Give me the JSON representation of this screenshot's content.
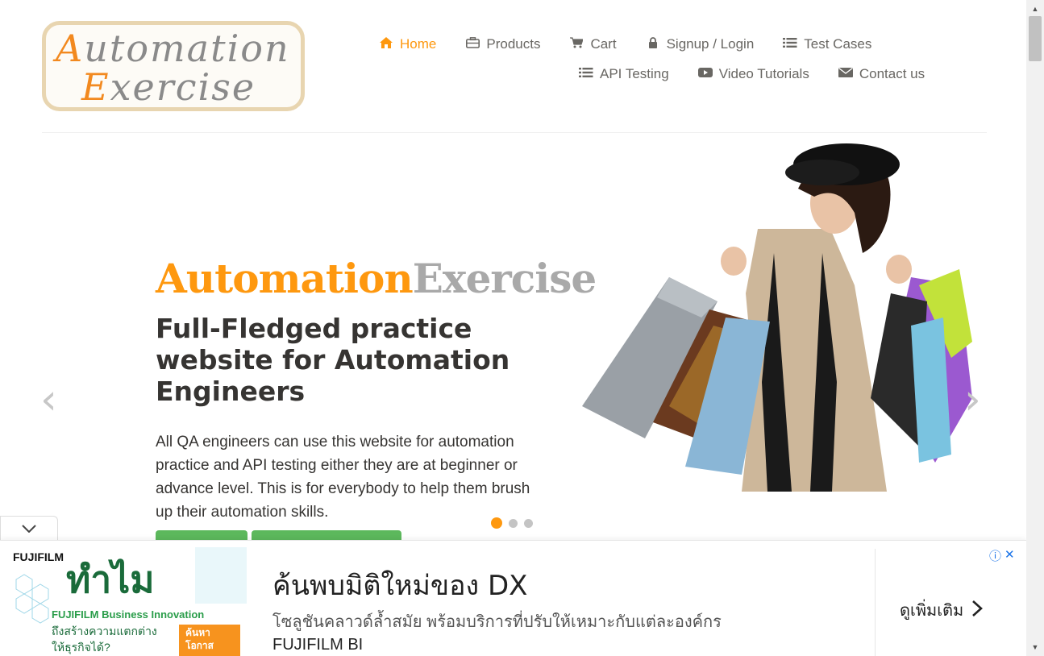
{
  "logo": {
    "line1_cap": "A",
    "line1_rest": "utomation",
    "line2_cap": "E",
    "line2_rest": "xercise"
  },
  "nav": {
    "row1": [
      {
        "label": "Home",
        "icon": "home-icon",
        "active": true
      },
      {
        "label": "Products",
        "icon": "briefcase-icon"
      },
      {
        "label": "Cart",
        "icon": "cart-icon"
      },
      {
        "label": "Signup / Login",
        "icon": "lock-icon"
      },
      {
        "label": "Test Cases",
        "icon": "list-icon"
      }
    ],
    "row2": [
      {
        "label": "API Testing",
        "icon": "list-icon"
      },
      {
        "label": "Video Tutorials",
        "icon": "youtube-icon"
      },
      {
        "label": "Contact us",
        "icon": "envelope-icon"
      }
    ]
  },
  "slider": {
    "brand_part1": "Automation",
    "brand_part2": "Exercise",
    "headline": "Full-Fledged practice website for Automation Engineers",
    "description": "All QA engineers can use this website for automation practice and API testing either they are at beginner or advance level. This is for everybody to help them brush up their automation skills.",
    "prev_arrow": "‹",
    "next_arrow": "›",
    "active_slide": 1,
    "slide_count": 3
  },
  "ad": {
    "brand": "FUJIFILM",
    "big_text": "ทำไม",
    "sub1": "FUJIFILM Business Innovation",
    "sub2": "ถึงสร้างความแตกต่าง",
    "sub3": "ให้ธุรกิจได้?",
    "badge": "ค้นหา โอกาส",
    "title": "ค้นพบมิติใหม่ของ DX",
    "description": "โซลูชันคลาวด์ล้ำสมัย พร้อมบริการที่ปรับให้เหมาะกับแต่ละองค์กร",
    "source": "FUJIFILM BI",
    "cta": "ดูเพิ่มเติม",
    "info_icon": "ⓘ",
    "close_icon": "✕"
  },
  "colors": {
    "accent": "#fe980f",
    "text": "#696763",
    "dark": "#363432",
    "green": "#5cb85c"
  }
}
